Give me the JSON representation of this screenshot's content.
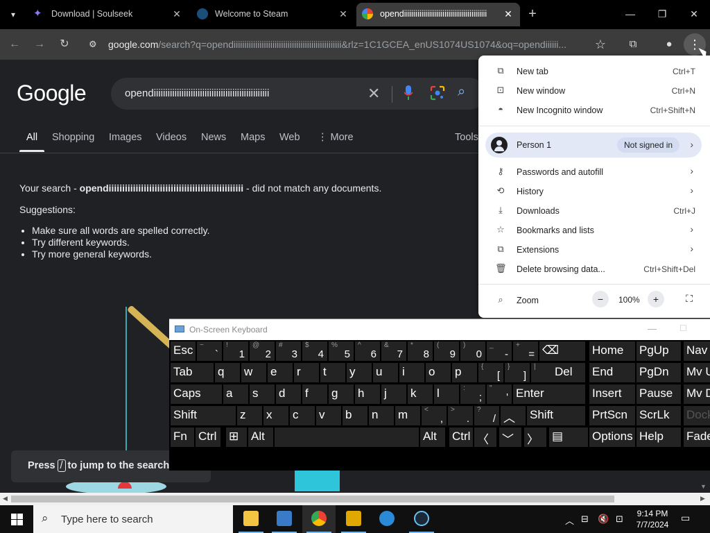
{
  "tabs": [
    {
      "title": "Download | Soulseek",
      "close": "✕"
    },
    {
      "title": "Welcome to Steam",
      "close": "✕"
    },
    {
      "title": "opendiiiiiiiiiiiiiiiiiiiiiiiiiiiiiiiiiiiiiiiiiii",
      "close": "✕"
    }
  ],
  "new_tab_symbol": "+",
  "window_controls": {
    "minimize": "—",
    "restore": "❐",
    "close": "✕"
  },
  "omnibox": {
    "host": "google.com",
    "rest": "/search?q=opendiiiiiiiiiiiiiiiiiiiiiiiiiiiiiiiiiiiiiiiiiiiiiiiiii&rlz=1C1GCEA_enUS1074US1074&oq=opendiiiiii..."
  },
  "google": {
    "logo": "Google",
    "query": "opendiiiiiiiiiiiiiiiiiiiiiiiiiiiiiiiiiiiiiiiiiiiiiiiiii",
    "nav": [
      "All",
      "Shopping",
      "Images",
      "Videos",
      "News",
      "Maps",
      "Web",
      "⋮ More"
    ],
    "tools": "Tools",
    "result": {
      "prefix": "Your search - ",
      "term": "opendiiiiiiiiiiiiiiiiiiiiiiiiiiiiiiiiiiiiiiiiiiiiiiiiii",
      "suffix": " - did not match any documents.",
      "suggestions_title": "Suggestions:",
      "suggestions": [
        "Make sure all words are spelled correctly.",
        "Try different keywords.",
        "Try more general keywords."
      ]
    },
    "hint": {
      "press": "Press",
      "key": "/",
      "rest": "to jump to the search box"
    }
  },
  "menu": {
    "items_top": [
      {
        "label": "New tab",
        "shortcut": "Ctrl+T",
        "icon": "new-tab-icon"
      },
      {
        "label": "New window",
        "shortcut": "Ctrl+N",
        "icon": "new-window-icon"
      },
      {
        "label": "New Incognito window",
        "shortcut": "Ctrl+Shift+N",
        "icon": "incognito-icon"
      }
    ],
    "person": {
      "name": "Person 1",
      "status": "Not signed in"
    },
    "items_mid": [
      {
        "label": "Passwords and autofill",
        "shortcut": "",
        "icon": "key-icon",
        "arrow": true
      },
      {
        "label": "History",
        "shortcut": "",
        "icon": "history-icon",
        "arrow": true
      },
      {
        "label": "Downloads",
        "shortcut": "Ctrl+J",
        "icon": "download-icon",
        "arrow": false
      },
      {
        "label": "Bookmarks and lists",
        "shortcut": "",
        "icon": "star-icon",
        "arrow": true
      },
      {
        "label": "Extensions",
        "shortcut": "",
        "icon": "puzzle-icon",
        "arrow": true
      },
      {
        "label": "Delete browsing data...",
        "shortcut": "Ctrl+Shift+Del",
        "icon": "trash-icon",
        "arrow": false
      }
    ],
    "zoom": {
      "label": "Zoom",
      "minus": "−",
      "value": "100%",
      "plus": "+"
    }
  },
  "osk": {
    "title": "On-Screen Keyboard",
    "rows": [
      [
        {
          "m": "Esc"
        },
        {
          "s": "~",
          "b": "`"
        },
        {
          "s": "!",
          "b": "1"
        },
        {
          "s": "@",
          "b": "2"
        },
        {
          "s": "#",
          "b": "3"
        },
        {
          "s": "$",
          "b": "4"
        },
        {
          "s": "%",
          "b": "5"
        },
        {
          "s": "^",
          "b": "6"
        },
        {
          "s": "&",
          "b": "7"
        },
        {
          "s": "*",
          "b": "8"
        },
        {
          "s": "(",
          "b": "9"
        },
        {
          "s": ")",
          "b": "0"
        },
        {
          "s": "_",
          "b": "-"
        },
        {
          "s": "+",
          "b": "="
        },
        {
          "m": "⌫"
        },
        {
          "m": "Home"
        },
        {
          "m": "PgUp"
        },
        {
          "m": "Nav"
        }
      ],
      [
        {
          "m": "Tab"
        },
        {
          "m": "q"
        },
        {
          "m": "w"
        },
        {
          "m": "e"
        },
        {
          "m": "r"
        },
        {
          "m": "t"
        },
        {
          "m": "y"
        },
        {
          "m": "u"
        },
        {
          "m": "i"
        },
        {
          "m": "o"
        },
        {
          "m": "p"
        },
        {
          "s": "{",
          "b": "["
        },
        {
          "s": "}",
          "b": "]"
        },
        {
          "s": "|",
          "b": "\\"
        },
        {
          "m": "Del"
        },
        {
          "m": "End"
        },
        {
          "m": "PgDn"
        },
        {
          "m": "Mv Up"
        }
      ],
      [
        {
          "m": "Caps"
        },
        {
          "m": "a"
        },
        {
          "m": "s"
        },
        {
          "m": "d"
        },
        {
          "m": "f"
        },
        {
          "m": "g"
        },
        {
          "m": "h"
        },
        {
          "m": "j"
        },
        {
          "m": "k"
        },
        {
          "m": "l"
        },
        {
          "s": ":",
          "b": ";"
        },
        {
          "s": "\"",
          "b": "'"
        },
        {
          "m": "Enter"
        },
        {
          "m": "Insert"
        },
        {
          "m": "Pause"
        },
        {
          "m": "Mv Dn"
        }
      ],
      [
        {
          "m": "Shift"
        },
        {
          "m": "z"
        },
        {
          "m": "x"
        },
        {
          "m": "c"
        },
        {
          "m": "v"
        },
        {
          "m": "b"
        },
        {
          "m": "n"
        },
        {
          "m": "m"
        },
        {
          "s": "<",
          "b": ","
        },
        {
          "s": ">",
          "b": "."
        },
        {
          "s": "?",
          "b": "/"
        },
        {
          "m": "︿"
        },
        {
          "m": "Shift"
        },
        {
          "m": "PrtScn"
        },
        {
          "m": "ScrLk"
        },
        {
          "m": "Dock"
        }
      ],
      [
        {
          "m": "Fn"
        },
        {
          "m": "Ctrl"
        },
        {
          "m": "⊞"
        },
        {
          "m": "Alt"
        },
        {
          "m": ""
        },
        {
          "m": "Alt"
        },
        {
          "m": "Ctrl"
        },
        {
          "m": "〈"
        },
        {
          "m": "﹀"
        },
        {
          "m": "〉"
        },
        {
          "m": "▤"
        },
        {
          "m": "Options"
        },
        {
          "m": "Help"
        },
        {
          "m": "Fade"
        }
      ]
    ]
  },
  "taskbar": {
    "search_placeholder": "Type here to search",
    "time": "9:14 PM",
    "date": "7/7/2024"
  }
}
